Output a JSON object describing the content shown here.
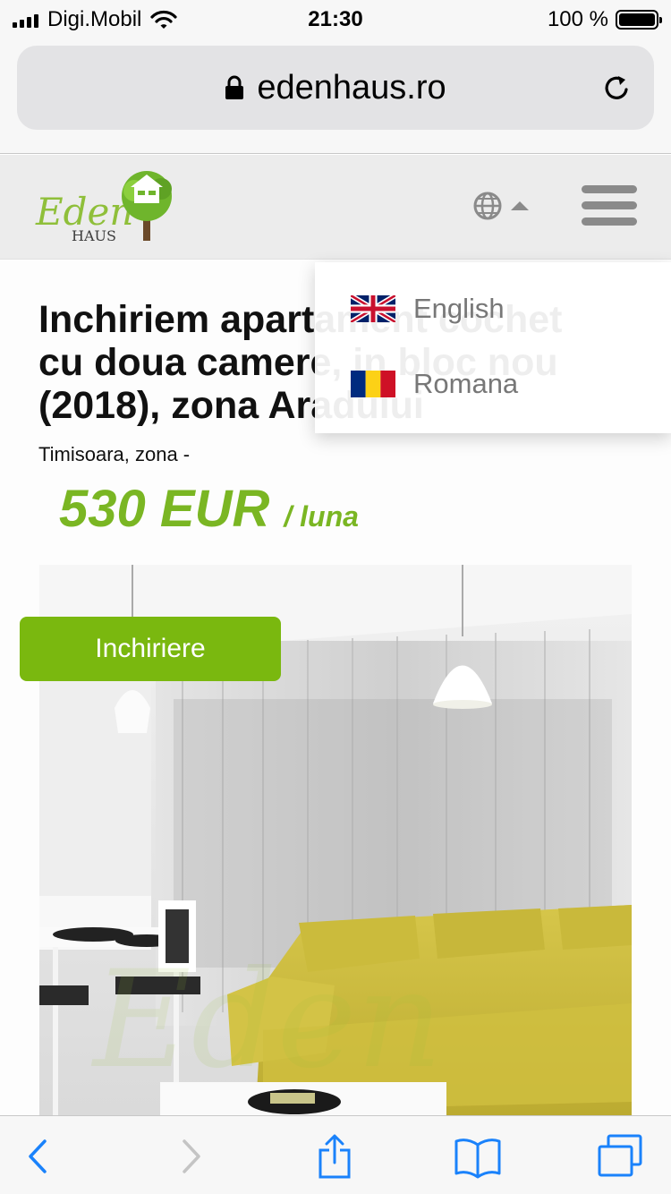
{
  "status_bar": {
    "carrier": "Digi.Mobil",
    "time": "21:30",
    "battery_percent": "100 %"
  },
  "browser": {
    "url": "edenhaus.ro"
  },
  "site_header": {
    "logo_alt": "Eden HAUS",
    "logo_word": "Eden",
    "logo_sub": "HAUS"
  },
  "listing": {
    "title": "Inchiriem apartament cochet cu doua camere, in bloc nou (2018), zona Aradului",
    "location": "Timisoara, zona -",
    "price": "530 EUR",
    "price_unit": "/ luna",
    "badge": "Inchiriere"
  },
  "language_menu": {
    "items": [
      {
        "label": "English"
      },
      {
        "label": "Romana"
      }
    ]
  },
  "colors": {
    "accent_green": "#7ab623",
    "badge_green": "#7ab80f",
    "ios_blue": "#1a82fb"
  }
}
